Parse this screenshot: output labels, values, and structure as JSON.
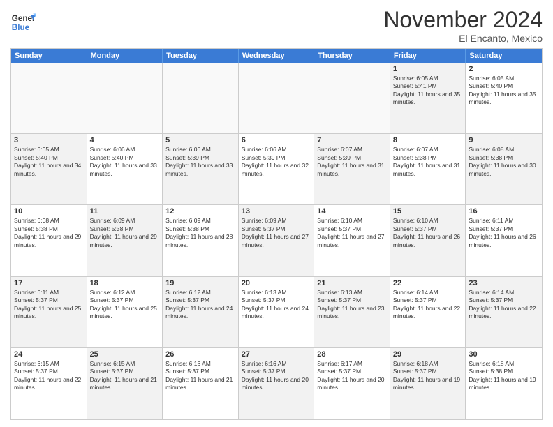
{
  "header": {
    "logo_general": "General",
    "logo_blue": "Blue",
    "month_title": "November 2024",
    "location": "El Encanto, Mexico"
  },
  "calendar": {
    "days_of_week": [
      "Sunday",
      "Monday",
      "Tuesday",
      "Wednesday",
      "Thursday",
      "Friday",
      "Saturday"
    ],
    "rows": [
      [
        {
          "day": "",
          "info": "",
          "empty": true
        },
        {
          "day": "",
          "info": "",
          "empty": true
        },
        {
          "day": "",
          "info": "",
          "empty": true
        },
        {
          "day": "",
          "info": "",
          "empty": true
        },
        {
          "day": "",
          "info": "",
          "empty": true
        },
        {
          "day": "1",
          "info": "Sunrise: 6:05 AM\nSunset: 5:41 PM\nDaylight: 11 hours and 35 minutes.",
          "shaded": true
        },
        {
          "day": "2",
          "info": "Sunrise: 6:05 AM\nSunset: 5:40 PM\nDaylight: 11 hours and 35 minutes.",
          "shaded": false
        }
      ],
      [
        {
          "day": "3",
          "info": "Sunrise: 6:05 AM\nSunset: 5:40 PM\nDaylight: 11 hours and 34 minutes.",
          "shaded": true
        },
        {
          "day": "4",
          "info": "Sunrise: 6:06 AM\nSunset: 5:40 PM\nDaylight: 11 hours and 33 minutes.",
          "shaded": false
        },
        {
          "day": "5",
          "info": "Sunrise: 6:06 AM\nSunset: 5:39 PM\nDaylight: 11 hours and 33 minutes.",
          "shaded": true
        },
        {
          "day": "6",
          "info": "Sunrise: 6:06 AM\nSunset: 5:39 PM\nDaylight: 11 hours and 32 minutes.",
          "shaded": false
        },
        {
          "day": "7",
          "info": "Sunrise: 6:07 AM\nSunset: 5:39 PM\nDaylight: 11 hours and 31 minutes.",
          "shaded": true
        },
        {
          "day": "8",
          "info": "Sunrise: 6:07 AM\nSunset: 5:38 PM\nDaylight: 11 hours and 31 minutes.",
          "shaded": false
        },
        {
          "day": "9",
          "info": "Sunrise: 6:08 AM\nSunset: 5:38 PM\nDaylight: 11 hours and 30 minutes.",
          "shaded": true
        }
      ],
      [
        {
          "day": "10",
          "info": "Sunrise: 6:08 AM\nSunset: 5:38 PM\nDaylight: 11 hours and 29 minutes.",
          "shaded": false
        },
        {
          "day": "11",
          "info": "Sunrise: 6:09 AM\nSunset: 5:38 PM\nDaylight: 11 hours and 29 minutes.",
          "shaded": true
        },
        {
          "day": "12",
          "info": "Sunrise: 6:09 AM\nSunset: 5:38 PM\nDaylight: 11 hours and 28 minutes.",
          "shaded": false
        },
        {
          "day": "13",
          "info": "Sunrise: 6:09 AM\nSunset: 5:37 PM\nDaylight: 11 hours and 27 minutes.",
          "shaded": true
        },
        {
          "day": "14",
          "info": "Sunrise: 6:10 AM\nSunset: 5:37 PM\nDaylight: 11 hours and 27 minutes.",
          "shaded": false
        },
        {
          "day": "15",
          "info": "Sunrise: 6:10 AM\nSunset: 5:37 PM\nDaylight: 11 hours and 26 minutes.",
          "shaded": true
        },
        {
          "day": "16",
          "info": "Sunrise: 6:11 AM\nSunset: 5:37 PM\nDaylight: 11 hours and 26 minutes.",
          "shaded": false
        }
      ],
      [
        {
          "day": "17",
          "info": "Sunrise: 6:11 AM\nSunset: 5:37 PM\nDaylight: 11 hours and 25 minutes.",
          "shaded": true
        },
        {
          "day": "18",
          "info": "Sunrise: 6:12 AM\nSunset: 5:37 PM\nDaylight: 11 hours and 25 minutes.",
          "shaded": false
        },
        {
          "day": "19",
          "info": "Sunrise: 6:12 AM\nSunset: 5:37 PM\nDaylight: 11 hours and 24 minutes.",
          "shaded": true
        },
        {
          "day": "20",
          "info": "Sunrise: 6:13 AM\nSunset: 5:37 PM\nDaylight: 11 hours and 24 minutes.",
          "shaded": false
        },
        {
          "day": "21",
          "info": "Sunrise: 6:13 AM\nSunset: 5:37 PM\nDaylight: 11 hours and 23 minutes.",
          "shaded": true
        },
        {
          "day": "22",
          "info": "Sunrise: 6:14 AM\nSunset: 5:37 PM\nDaylight: 11 hours and 22 minutes.",
          "shaded": false
        },
        {
          "day": "23",
          "info": "Sunrise: 6:14 AM\nSunset: 5:37 PM\nDaylight: 11 hours and 22 minutes.",
          "shaded": true
        }
      ],
      [
        {
          "day": "24",
          "info": "Sunrise: 6:15 AM\nSunset: 5:37 PM\nDaylight: 11 hours and 22 minutes.",
          "shaded": false
        },
        {
          "day": "25",
          "info": "Sunrise: 6:15 AM\nSunset: 5:37 PM\nDaylight: 11 hours and 21 minutes.",
          "shaded": true
        },
        {
          "day": "26",
          "info": "Sunrise: 6:16 AM\nSunset: 5:37 PM\nDaylight: 11 hours and 21 minutes.",
          "shaded": false
        },
        {
          "day": "27",
          "info": "Sunrise: 6:16 AM\nSunset: 5:37 PM\nDaylight: 11 hours and 20 minutes.",
          "shaded": true
        },
        {
          "day": "28",
          "info": "Sunrise: 6:17 AM\nSunset: 5:37 PM\nDaylight: 11 hours and 20 minutes.",
          "shaded": false
        },
        {
          "day": "29",
          "info": "Sunrise: 6:18 AM\nSunset: 5:37 PM\nDaylight: 11 hours and 19 minutes.",
          "shaded": true
        },
        {
          "day": "30",
          "info": "Sunrise: 6:18 AM\nSunset: 5:38 PM\nDaylight: 11 hours and 19 minutes.",
          "shaded": false
        }
      ]
    ]
  }
}
